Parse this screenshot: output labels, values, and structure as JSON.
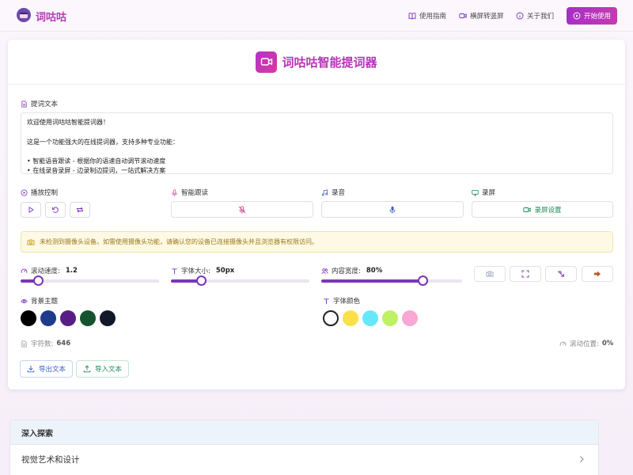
{
  "brand": {
    "name": "词咕咕"
  },
  "nav": {
    "guide": "使用指南",
    "rotate": "横屏转竖屏",
    "about": "关于我们",
    "start": "开始使用"
  },
  "header": {
    "title": "词咕咕智能提词器"
  },
  "script_section": {
    "label": "提词文本",
    "text": "欢迎使用词咕咕智能提词器！\n\n这是一个功能强大的在线提词器，支持多种专业功能：\n\n• 智能语音跟读 - 根据你的语速自动调节滚动速度\n• 在线录音录屏 - 边录制边提词，一站式解决方案"
  },
  "controls": {
    "playback_label": "播放控制",
    "follow_label": "智能跟读",
    "record_audio_label": "录音",
    "record_screen_label": "录屏",
    "screen_settings": "录屏设置"
  },
  "warning": "未检测到摄像头设备。如需使用摄像头功能，请确认您的设备已连接摄像头并且浏览器有权限访问。",
  "sliders": {
    "speed": {
      "label": "滚动速度:",
      "value_text": "1.2",
      "fraction": 0.13
    },
    "font_size": {
      "label": "字体大小:",
      "value_text": "50px",
      "fraction": 0.22
    },
    "width": {
      "label": "内容宽度:",
      "value_text": "80%",
      "fraction": 0.72
    }
  },
  "background_theme": {
    "label": "背景主题",
    "colors": [
      "#000000",
      "#1e3a8a",
      "#581c87",
      "#14532d",
      "#111827"
    ]
  },
  "font_color": {
    "label": "字体颜色",
    "colors": [
      "#ffffff",
      "#fde047",
      "#67e8f9",
      "#bef264",
      "#f9a8d4"
    ]
  },
  "stats": {
    "char_count_label": "字符数:",
    "char_count": "646",
    "scroll_pos_label": "滚动位置:",
    "scroll_pos": "0%"
  },
  "io": {
    "export": "导出文本",
    "import": "导入文本"
  },
  "explore": {
    "title": "深入探索",
    "items": [
      "视觉艺术和设计"
    ]
  },
  "accent_color": "#7a35b8"
}
